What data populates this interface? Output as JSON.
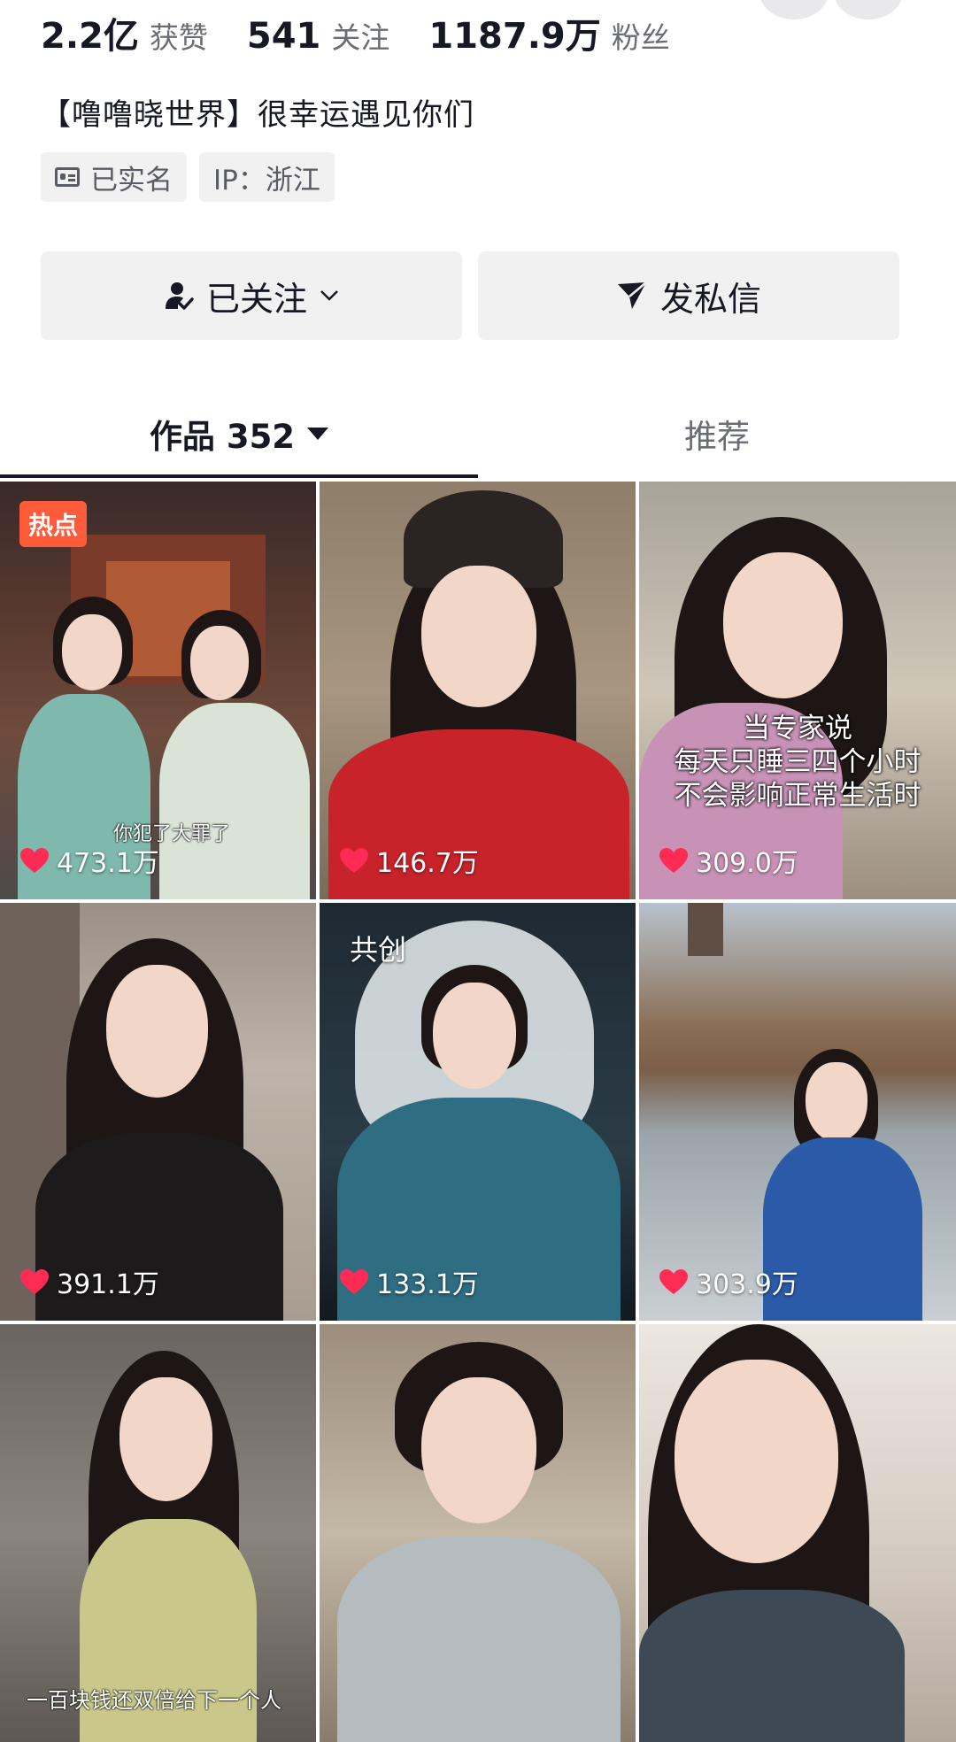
{
  "stats": [
    {
      "num": "2.2亿",
      "label": "获赞"
    },
    {
      "num": "541",
      "label": "关注"
    },
    {
      "num": "1187.9万",
      "label": "粉丝"
    }
  ],
  "bio": "【噜噜晓世界】很幸运遇见你们",
  "tags": [
    {
      "label": "已实名",
      "icon": "id-card-icon"
    },
    {
      "label": "IP：浙江"
    }
  ],
  "buttons": {
    "follow": {
      "label": "已关注",
      "icon": "user-check-icon"
    },
    "message": {
      "label": "发私信",
      "icon": "send-icon"
    }
  },
  "tabs": {
    "works": "作品 352",
    "recommend": "推荐"
  },
  "videos": [
    {
      "likes": "473.1万",
      "badge": "热点",
      "caption": "你犯了大罪了"
    },
    {
      "likes": "146.7万"
    },
    {
      "likes": "309.0万",
      "overlay": [
        "当专家说",
        "每天只睡三四个小时",
        "不会影响正常生活时"
      ]
    },
    {
      "likes": "391.1万"
    },
    {
      "likes": "133.1万",
      "badge": "共创"
    },
    {
      "likes": "303.9万"
    },
    {
      "likes": "",
      "caption": "一百块钱还双倍给下一个人"
    },
    {
      "likes": ""
    },
    {
      "likes": ""
    }
  ],
  "colors": {
    "hot_badge": "#fe5b3a",
    "heart": "#fe2c55"
  }
}
